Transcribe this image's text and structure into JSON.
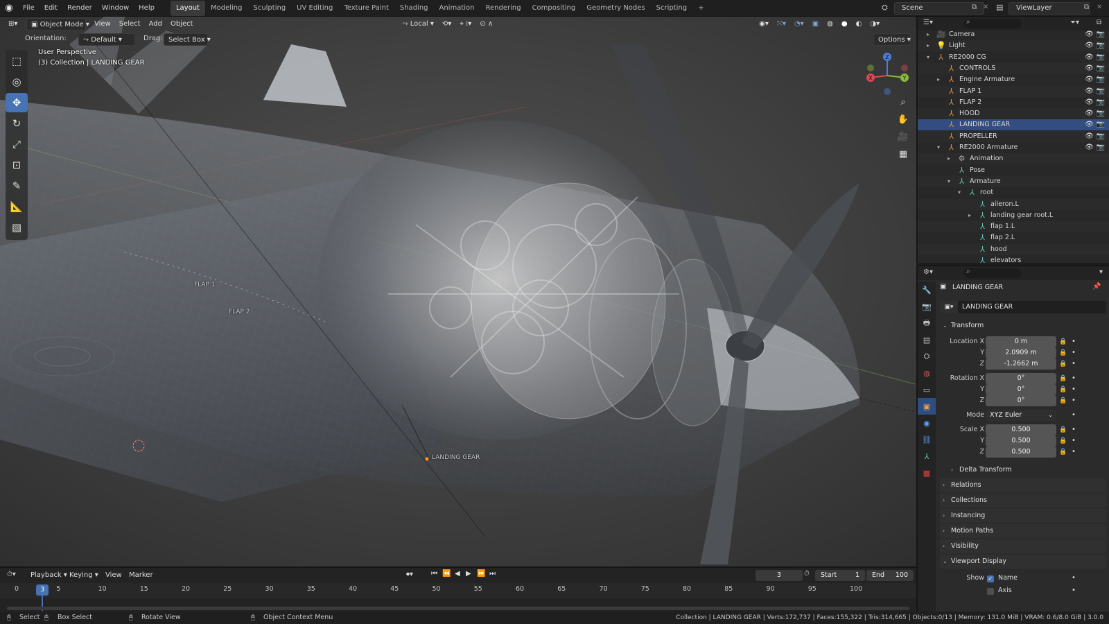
{
  "topbar": {
    "menus": [
      "File",
      "Edit",
      "Render",
      "Window",
      "Help"
    ],
    "workspaces": [
      "Layout",
      "Modeling",
      "Sculpting",
      "UV Editing",
      "Texture Paint",
      "Shading",
      "Animation",
      "Rendering",
      "Compositing",
      "Geometry Nodes",
      "Scripting"
    ],
    "active_workspace": "Layout",
    "add_tab": "+",
    "scene": "Scene",
    "view_layer": "ViewLayer"
  },
  "viewport": {
    "mode": "Object Mode",
    "menus": [
      "View",
      "Select",
      "Add",
      "Object"
    ],
    "transform_orientation": "Local",
    "orientation_label": "Orientation:",
    "orientation_value": "Default",
    "drag_label": "Drag:",
    "drag_value": "Select Box",
    "options": "Options",
    "perspective": "User Perspective",
    "collection_info": "(3) Collection | LANDING GEAR",
    "labels": {
      "flap1": "FLAP 1",
      "flap2": "FLAP 2",
      "landing_gear": "LANDING GEAR"
    },
    "gizmo": {
      "x": "X",
      "y": "Y",
      "z": "Z"
    }
  },
  "outliner": {
    "rows": [
      {
        "label": "Camera",
        "type": "camera"
      },
      {
        "label": "Light",
        "type": "light"
      },
      {
        "label": "RE2000 CG",
        "type": "armature"
      },
      {
        "label": "CONTROLS",
        "type": "armature"
      },
      {
        "label": "Engine Armature",
        "type": "armature"
      },
      {
        "label": "FLAP 1",
        "type": "armature"
      },
      {
        "label": "FLAP 2",
        "type": "armature"
      },
      {
        "label": "HOOD",
        "type": "armature"
      },
      {
        "label": "LANDING GEAR",
        "type": "armature"
      },
      {
        "label": "PROPELLER",
        "type": "armature"
      },
      {
        "label": "RE2000 Armature",
        "type": "armature"
      },
      {
        "label": "Animation",
        "type": "anim"
      },
      {
        "label": "Pose",
        "type": "pose"
      },
      {
        "label": "Armature",
        "type": "arm-data"
      },
      {
        "label": "root",
        "type": "bone"
      },
      {
        "label": "aileron.L",
        "type": "bone"
      },
      {
        "label": "landing gear root.L",
        "type": "bone"
      },
      {
        "label": "flap 1.L",
        "type": "bone"
      },
      {
        "label": "flap 2.L",
        "type": "bone"
      },
      {
        "label": "hood",
        "type": "bone"
      },
      {
        "label": "elevators",
        "type": "bone"
      }
    ]
  },
  "properties": {
    "object_name": "LANDING GEAR",
    "object_field": "LANDING GEAR",
    "transform": {
      "title": "Transform",
      "location_label": "Location X",
      "location": [
        "0 m",
        "2.0909 m",
        "-1.2662 m"
      ],
      "rotation_label": "Rotation X",
      "rotation": [
        "0°",
        "0°",
        "0°"
      ],
      "mode_label": "Mode",
      "mode": "XYZ Euler",
      "scale_label": "Scale X",
      "scale": [
        "0.500",
        "0.500",
        "0.500"
      ],
      "axis_y": "Y",
      "axis_z": "Z"
    },
    "panels": [
      "Delta Transform",
      "Relations",
      "Collections",
      "Instancing",
      "Motion Paths",
      "Visibility",
      "Viewport Display"
    ],
    "viewport_display": {
      "show_label": "Show",
      "name": "Name",
      "axis": "Axis",
      "name_checked": true,
      "axis_checked": false
    }
  },
  "timeline": {
    "menus": [
      "Playback",
      "Keying",
      "View",
      "Marker"
    ],
    "current_frame": "3",
    "start_label": "Start",
    "start": "1",
    "end_label": "End",
    "end": "100",
    "ticks": [
      "0",
      "5",
      "10",
      "15",
      "20",
      "25",
      "30",
      "35",
      "40",
      "45",
      "50",
      "55",
      "60",
      "65",
      "70",
      "75",
      "80",
      "85",
      "90",
      "95",
      "100"
    ]
  },
  "statusbar": {
    "select": "Select",
    "box_select": "Box Select",
    "rotate_view": "Rotate View",
    "context_menu": "Object Context Menu",
    "stats": "Collection | LANDING GEAR | Verts:172,737 | Faces:155,322 | Tris:314,665 | Objects:0/13 | Memory: 131.0 MiB | VRAM: 0.6/8.0 GiB | 3.0.0"
  },
  "colors": {
    "accent": "#4772b3",
    "selected_row": "#334d80",
    "armature": "#e59040",
    "bone": "#5fc6b4"
  }
}
